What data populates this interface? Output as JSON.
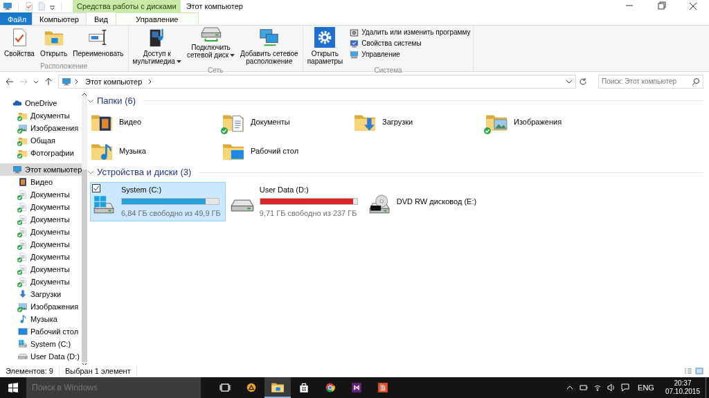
{
  "title_bar": {
    "quick_access": [
      {
        "kind": "properties"
      },
      {
        "kind": "new-folder"
      }
    ],
    "contextual_group": "Средства работы с дисками",
    "title": "Этот компьютер"
  },
  "ribbon_tabs": [
    {
      "label": "Файл",
      "kind": "file",
      "selected": false
    },
    {
      "label": "Компьютер",
      "kind": "normal",
      "selected": true
    },
    {
      "label": "Вид",
      "kind": "normal",
      "selected": false
    },
    {
      "label": "Управление",
      "kind": "contextual",
      "selected": false
    }
  ],
  "ribbon_groups": [
    {
      "label": "Расположение",
      "buttons": [
        {
          "label": "Свойства",
          "kind": "properties",
          "dropdown": false
        },
        {
          "label": "Открыть",
          "kind": "open",
          "dropdown": false
        },
        {
          "label": "Переименовать",
          "kind": "rename",
          "dropdown": false
        }
      ]
    },
    {
      "label": "Сеть",
      "buttons": [
        {
          "label": "Доступ к\nмультимедиа",
          "kind": "media",
          "dropdown": true
        },
        {
          "label": "Подключить\nсетевой диск",
          "kind": "map-drive",
          "dropdown": true
        },
        {
          "label": "Добавить сетевое\nрасположение",
          "kind": "net-location",
          "dropdown": false
        }
      ]
    },
    {
      "label": "Система",
      "buttons": [
        {
          "label": "Открыть\nпараметры",
          "kind": "settings",
          "dropdown": false
        }
      ],
      "small_buttons": [
        {
          "label": "Удалить или изменить программу",
          "kind": "uninstall"
        },
        {
          "label": "Свойства системы",
          "kind": "sysprops"
        },
        {
          "label": "Управление",
          "kind": "manage"
        }
      ]
    }
  ],
  "address_bar": {
    "path": [
      "Этот компьютер"
    ],
    "search_placeholder": "Поиск: Этот компьютер"
  },
  "navigation": {
    "items": [
      {
        "label": "OneDrive",
        "kind": "onedrive",
        "selected": false,
        "synced": false,
        "children": [
          {
            "label": "Документы",
            "kind": "folder",
            "selected": false,
            "synced": true
          },
          {
            "label": "Изображения",
            "kind": "pictures",
            "selected": false,
            "synced": true
          },
          {
            "label": "Общая",
            "kind": "folder",
            "selected": false,
            "synced": true
          },
          {
            "label": "Фотографии",
            "kind": "folder",
            "selected": false,
            "synced": true
          }
        ]
      },
      {
        "label": "Этот компьютер",
        "kind": "computer",
        "selected": true,
        "synced": false,
        "children": [
          {
            "label": "Видео",
            "kind": "video",
            "selected": false,
            "synced": false
          },
          {
            "label": "Документы",
            "kind": "docs",
            "selected": false,
            "synced": true
          },
          {
            "label": "Документы",
            "kind": "docs",
            "selected": false,
            "synced": true
          },
          {
            "label": "Документы",
            "kind": "docs",
            "selected": false,
            "synced": true
          },
          {
            "label": "Документы",
            "kind": "docs",
            "selected": false,
            "synced": true
          },
          {
            "label": "Документы",
            "kind": "docs",
            "selected": false,
            "synced": true
          },
          {
            "label": "Документы",
            "kind": "docs",
            "selected": false,
            "synced": true
          },
          {
            "label": "Документы",
            "kind": "docs",
            "selected": false,
            "synced": true
          },
          {
            "label": "Документы",
            "kind": "docs",
            "selected": false,
            "synced": true
          },
          {
            "label": "Загрузки",
            "kind": "downloads",
            "selected": false,
            "synced": false
          },
          {
            "label": "Изображения",
            "kind": "pictures",
            "selected": false,
            "synced": true
          },
          {
            "label": "Музыка",
            "kind": "music",
            "selected": false,
            "synced": false
          },
          {
            "label": "Рабочий стол",
            "kind": "desktop",
            "selected": false,
            "synced": false
          },
          {
            "label": "System (C:)",
            "kind": "drive-windows",
            "selected": false,
            "synced": false
          },
          {
            "label": "User Data (D:)",
            "kind": "drive",
            "selected": false,
            "synced": false
          }
        ]
      }
    ]
  },
  "sections": [
    {
      "title": "Папки (6)",
      "kind": "folders",
      "items": [
        {
          "label": "Видео",
          "kind": "folder-video",
          "selected": false,
          "synced": false
        },
        {
          "label": "Документы",
          "kind": "folder-docs",
          "selected": false,
          "synced": true
        },
        {
          "label": "Загрузки",
          "kind": "folder-downloads",
          "selected": false,
          "synced": false
        },
        {
          "label": "Изображения",
          "kind": "folder-pictures",
          "selected": false,
          "synced": true
        },
        {
          "label": "Музыка",
          "kind": "folder-music",
          "selected": false,
          "synced": false
        },
        {
          "label": "Рабочий стол",
          "kind": "folder-desktop",
          "selected": false,
          "synced": false
        }
      ]
    },
    {
      "title": "Устройства и диски (3)",
      "kind": "drives",
      "items": [
        {
          "label": "System (C:)",
          "kind": "drive-windows",
          "selected": true,
          "level": 0.863,
          "low_space": false,
          "free_space": "6,84 ГБ свободно из 49,9 ГБ"
        },
        {
          "label": "User Data (D:)",
          "kind": "drive",
          "selected": false,
          "level": 0.959,
          "low_space": true,
          "free_space": "9,71 ГБ свободно из 237 ГБ"
        },
        {
          "label": "DVD RW дисковод (E:)",
          "kind": "dvd",
          "selected": false
        }
      ]
    }
  ],
  "status_bar": {
    "item_count": "Элементов: 9",
    "selection": "Выбран 1 элемент"
  },
  "taskbar": {
    "search_placeholder": "Поиск в Windows",
    "apps": [
      {
        "kind": "task-view",
        "active": false
      },
      {
        "kind": "triangle-app",
        "active": false
      },
      {
        "kind": "explorer",
        "active": true
      },
      {
        "kind": "store",
        "active": false
      },
      {
        "kind": "browser",
        "active": false
      },
      {
        "kind": "ide",
        "active": false
      },
      {
        "kind": "red-app",
        "active": false
      }
    ],
    "language": "ENG",
    "time": "20:37",
    "date": "07.10.2015"
  }
}
